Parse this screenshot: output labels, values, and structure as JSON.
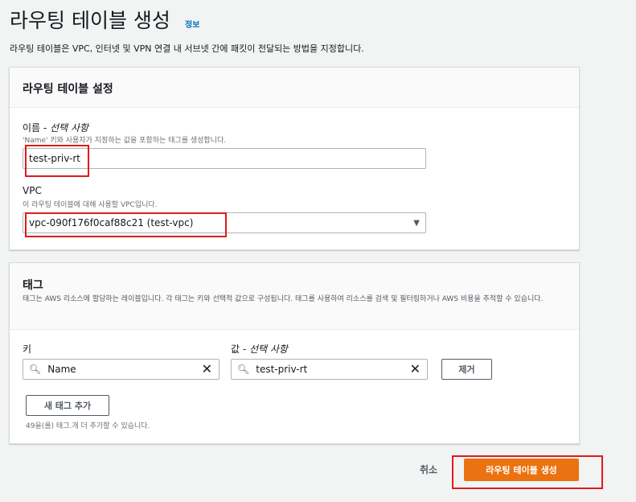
{
  "page": {
    "title": "라우팅 테이블 생성",
    "info_link": "정보",
    "description": "라우팅 테이블은 VPC, 인터넷 및 VPN 연결 내 서브넷 간에 패킷이 전달되는 방법을 지정합니다."
  },
  "settings": {
    "section_title": "라우팅 테이블 설정",
    "name_label": "이름 - ",
    "name_optional": "선택 사항",
    "name_hint": "'Name' 키와 사용자가 지정하는 값을 포함하는 태그를 생성합니다.",
    "name_value": "test-priv-rt",
    "vpc_label": "VPC",
    "vpc_hint": "이 라우팅 테이블에 대해 사용할 VPC입니다.",
    "vpc_value": "vpc-090f176f0caf88c21 (test-vpc)"
  },
  "tags": {
    "section_title": "태그",
    "description": "태그는 AWS 리소스에 할당하는 레이블입니다. 각 태그는 키와 선택적 값으로 구성됩니다. 태그를 사용하여 리소스를 검색 및 필터링하거나 AWS 비용을 추적할 수 있습니다.",
    "key_label": "키",
    "value_label": "값 - ",
    "value_optional": "선택 사항",
    "key_value": "Name",
    "value_value": "test-priv-rt",
    "remove_button": "제거",
    "add_button": "새 태그 추가",
    "remaining_text": "49을(를) 태그.개 더 추가할 수 있습니다."
  },
  "footer": {
    "cancel": "취소",
    "create": "라우팅 테이블 생성"
  },
  "icons": {
    "search": "search-icon",
    "clear": "close-icon",
    "caret": "caret-down-icon"
  },
  "colors": {
    "primary": "#ec7211",
    "link": "#0073bb",
    "highlight": "#e01b1b"
  }
}
